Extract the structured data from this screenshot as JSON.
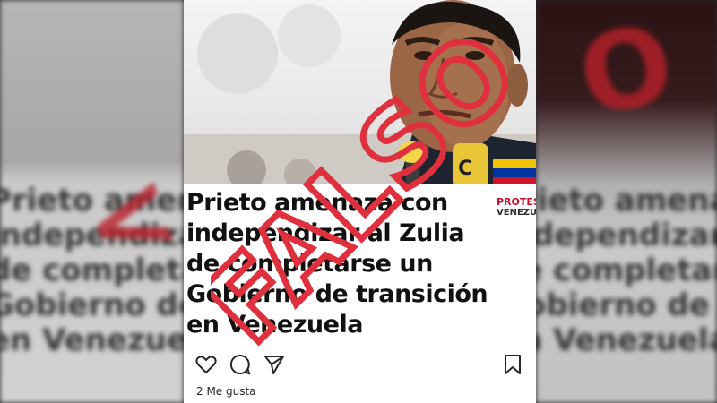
{
  "headline": {
    "line1": "Prieto amenaza con",
    "line2": "independizar al Zulia",
    "line3": "de completarse un",
    "line4": "Gobierno de transición",
    "line5": "en Venezuela"
  },
  "stamp": {
    "text": "FALSO",
    "color": "#e0303d"
  },
  "brand": {
    "line1": "PROTES",
    "line2": "VENEZUI"
  },
  "post": {
    "likes_label": "2 Me gusta"
  },
  "icons": {
    "like": "heart-icon",
    "comment": "comment-icon",
    "share": "send-icon",
    "save": "bookmark-icon"
  },
  "colors": {
    "text": "#111111",
    "stamp_red": "#e0303d",
    "flag_yellow": "#f4c300",
    "flag_blue": "#0033a0",
    "flag_red": "#cf142b"
  }
}
